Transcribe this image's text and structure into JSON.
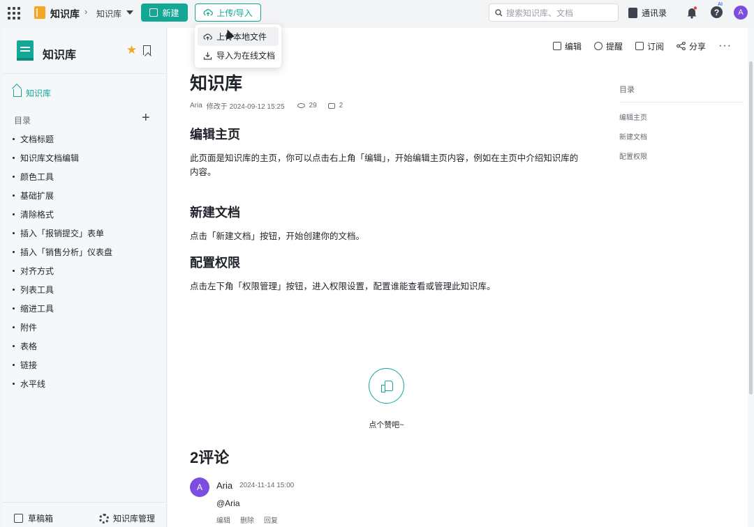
{
  "topbar": {
    "brand_title": "知识库",
    "breadcrumb": "知识库",
    "new_button": "新建",
    "upload_button": "上传/导入",
    "search_placeholder": "搜索知识库、文档",
    "contacts": "通讯录",
    "help": "?",
    "ai_badge": "AI",
    "avatar": "A",
    "accent_color": "#13a796",
    "avatar_color": "#7b4ee0"
  },
  "upload_menu": {
    "items": [
      "上传本地文件",
      "导入为在线文档"
    ]
  },
  "sidebar": {
    "title": "知识库",
    "home_label": "知识库",
    "toc_label": "目录",
    "items": [
      "文档标题",
      "知识库文档编辑",
      "颜色工具",
      "基础扩展",
      "清除格式",
      "插入「报销提交」表单",
      "插入「销售分析」仪表盘",
      "对齐方式",
      "列表工具",
      "缩进工具",
      "附件",
      "表格",
      "链接",
      "水平线"
    ],
    "drafts": "草稿箱",
    "manage": "知识库管理"
  },
  "toolbar": {
    "edit": "编辑",
    "remind": "提醒",
    "subscribe": "订阅",
    "share": "分享",
    "more": "···"
  },
  "doc": {
    "title": "知识库",
    "author": "Aria",
    "modified": "修改于 2024-09-12 15:25",
    "views": "29",
    "comments": "2",
    "sections": [
      {
        "heading": "编辑主页",
        "body": "此页面是知识库的主页，你可以点击右上角「编辑」，开始编辑主页内容，例如在主页中介绍知识库的内容。"
      },
      {
        "heading": "新建文档",
        "body": "点击「新建文档」按钮，开始创建你的文档。"
      },
      {
        "heading": "配置权限",
        "body": "点击左下角「权限管理」按钮，进入权限设置，配置谁能查看或管理此知识库。"
      }
    ]
  },
  "outline": {
    "title": "目录",
    "items": [
      "编辑主页",
      "新建文档",
      "配置权限"
    ]
  },
  "like": {
    "text": "点个赞吧~"
  },
  "comments": {
    "title": "2评论",
    "list": [
      {
        "avatar": "A",
        "name": "Aria",
        "time": "2024-11-14 15:00",
        "body": "@Aria",
        "actions": [
          "编辑",
          "删除",
          "回复"
        ]
      }
    ]
  }
}
